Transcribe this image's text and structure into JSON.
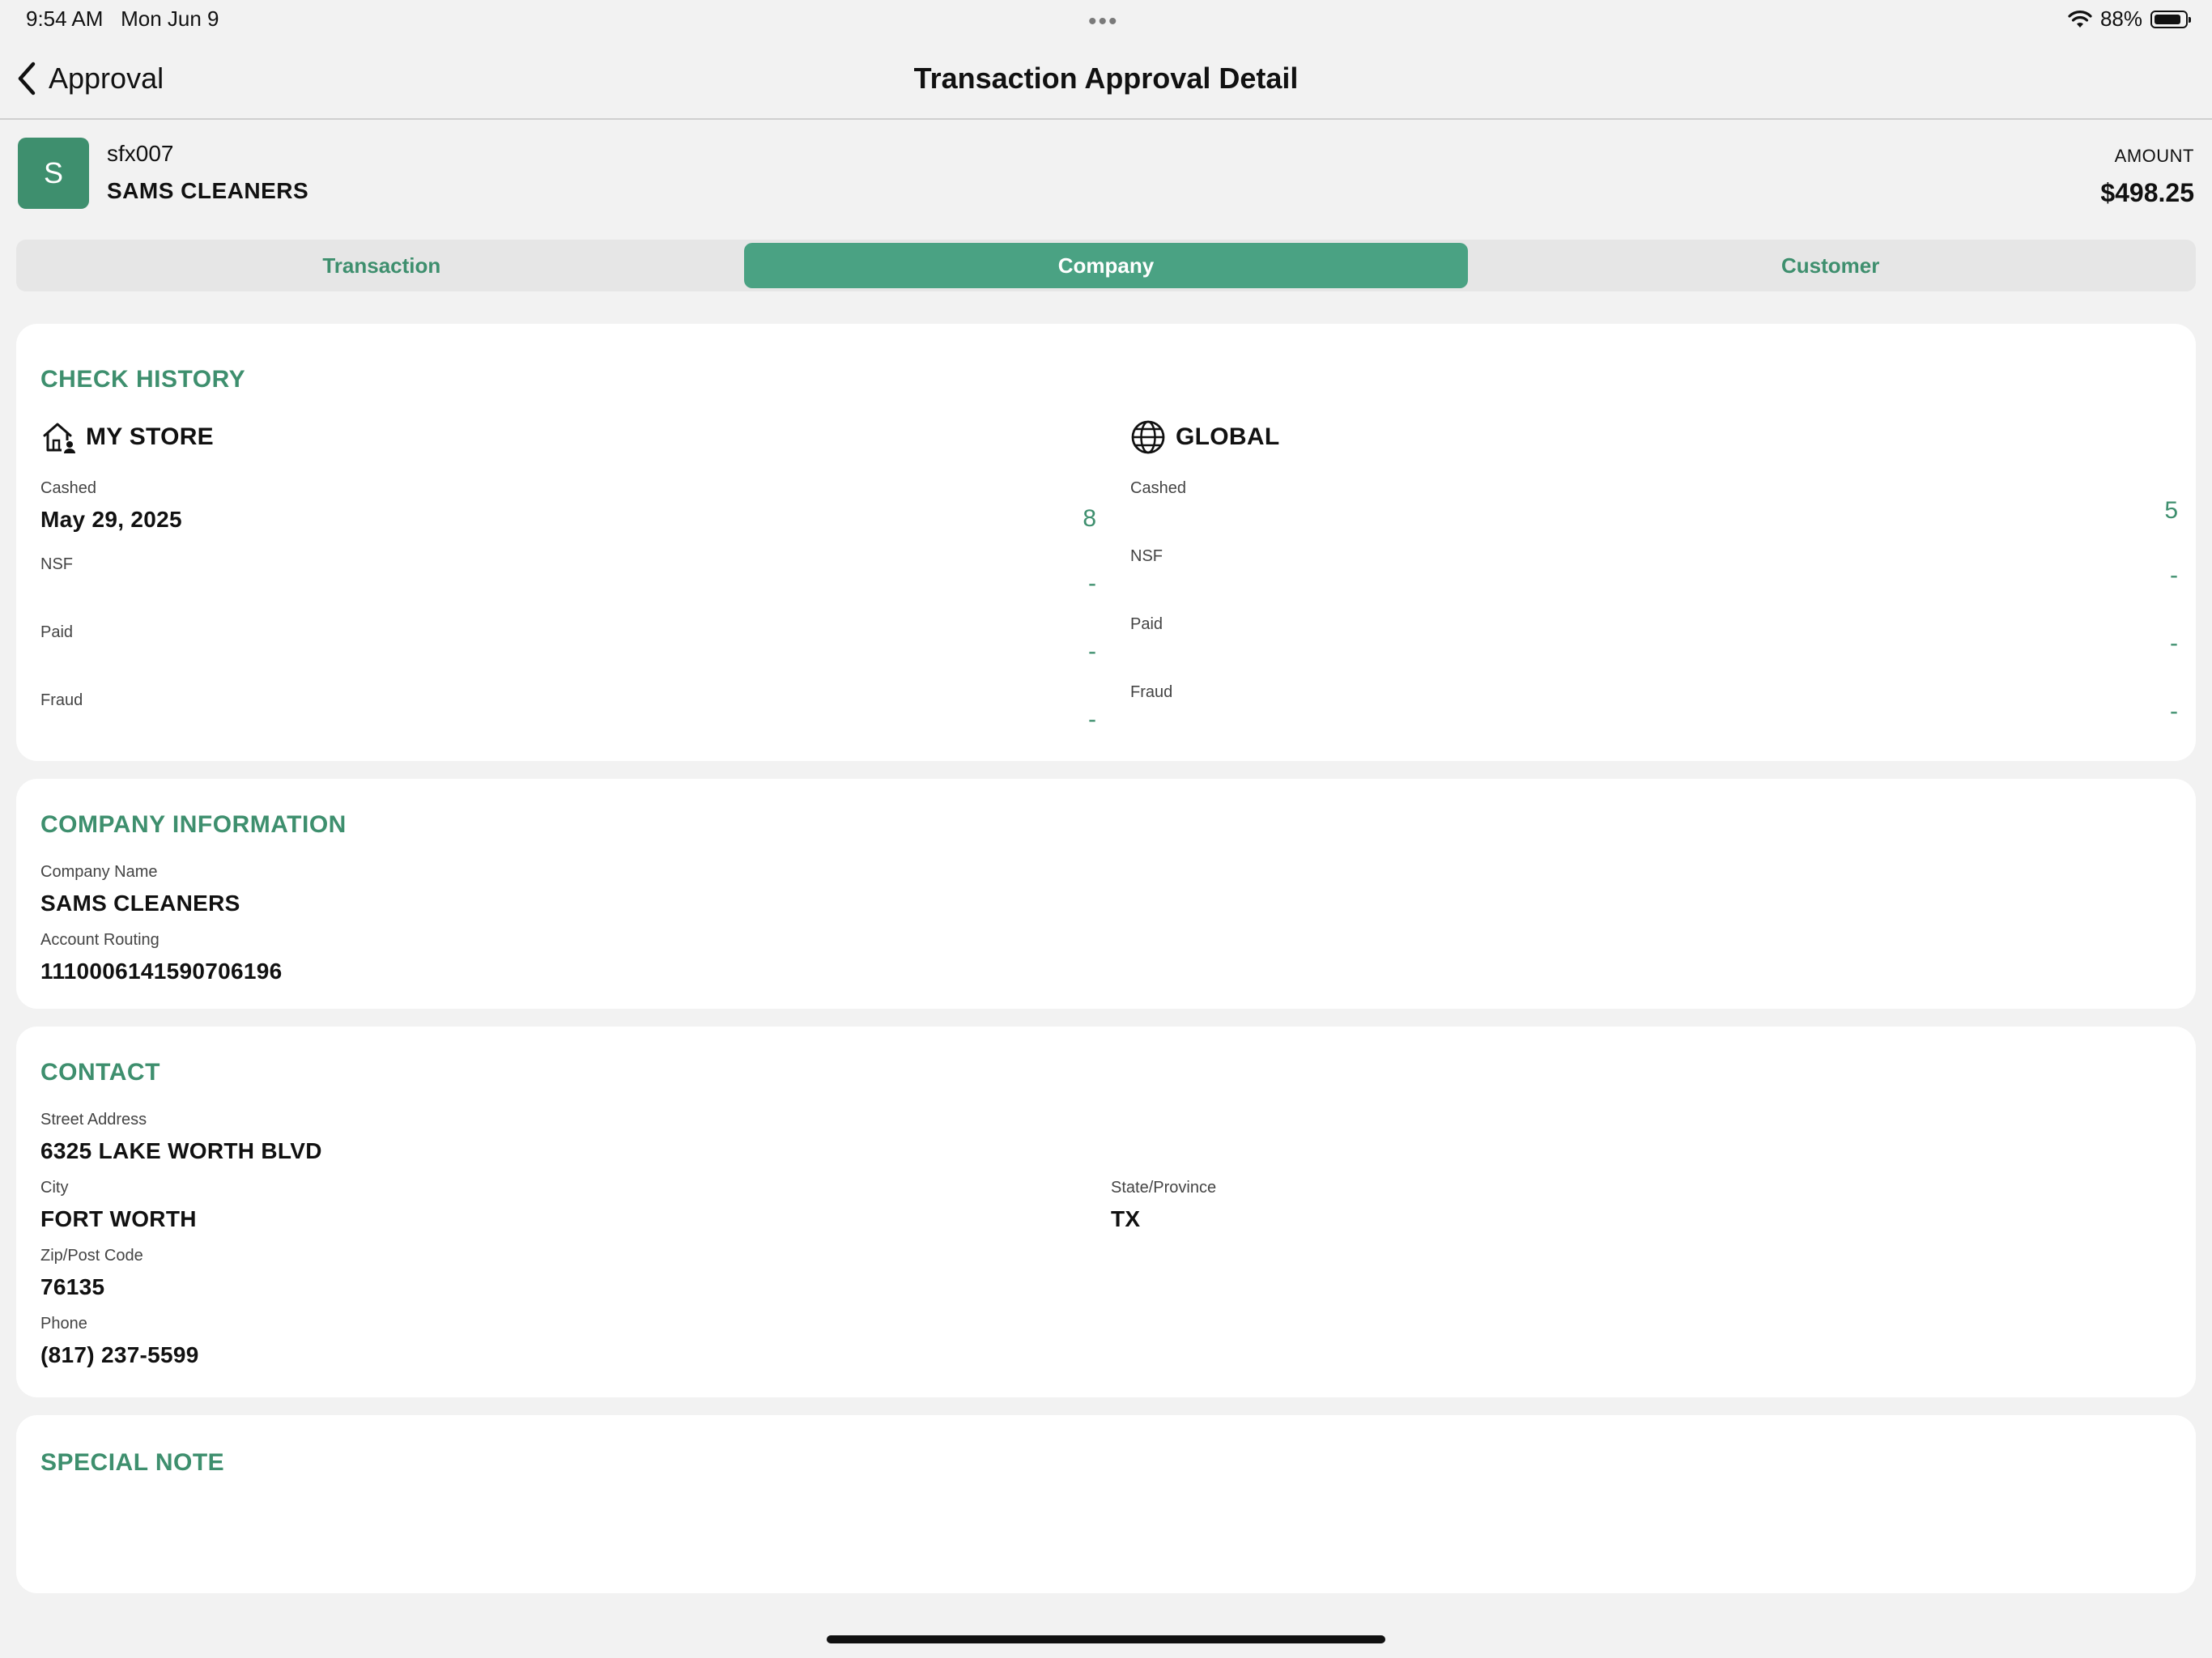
{
  "status_bar": {
    "time": "9:54 AM",
    "date": "Mon Jun 9",
    "dots": "•••",
    "battery_percent": "88%",
    "battery_level": 0.88
  },
  "nav": {
    "back_label": "Approval",
    "title": "Transaction Approval Detail"
  },
  "header": {
    "avatar_letter": "S",
    "id": "sfx007",
    "name": "SAMS CLEANERS",
    "amount_label": "AMOUNT",
    "amount_value": "$498.25"
  },
  "tabs": [
    {
      "label": "Transaction",
      "active": false
    },
    {
      "label": "Company",
      "active": true
    },
    {
      "label": "Customer",
      "active": false
    }
  ],
  "check_history": {
    "title": "CHECK HISTORY",
    "my_store": {
      "title": "MY STORE",
      "cashed_label": "Cashed",
      "cashed_date": "May 29, 2025",
      "cashed_count": "8",
      "nsf_label": "NSF",
      "nsf_value": "-",
      "paid_label": "Paid",
      "paid_value": "-",
      "fraud_label": "Fraud",
      "fraud_value": "-"
    },
    "global": {
      "title": "GLOBAL",
      "cashed_label": "Cashed",
      "cashed_count": "5",
      "nsf_label": "NSF",
      "nsf_value": "-",
      "paid_label": "Paid",
      "paid_value": "-",
      "fraud_label": "Fraud",
      "fraud_value": "-"
    }
  },
  "company_info": {
    "title": "COMPANY INFORMATION",
    "company_name_label": "Company Name",
    "company_name": "SAMS CLEANERS",
    "account_routing_label": "Account Routing",
    "account_routing": "1110006141590706196"
  },
  "contact": {
    "title": "CONTACT",
    "street_label": "Street Address",
    "street": "6325 LAKE WORTH BLVD",
    "city_label": "City",
    "city": "FORT WORTH",
    "state_label": "State/Province",
    "state": "TX",
    "zip_label": "Zip/Post Code",
    "zip": "76135",
    "phone_label": "Phone",
    "phone": "(817) 237-5599"
  },
  "special_note": {
    "title": "SPECIAL NOTE"
  },
  "colors": {
    "accent": "#3e8f6e",
    "segment_active": "#4aa283",
    "background": "#f2f2f2",
    "card": "#ffffff"
  }
}
